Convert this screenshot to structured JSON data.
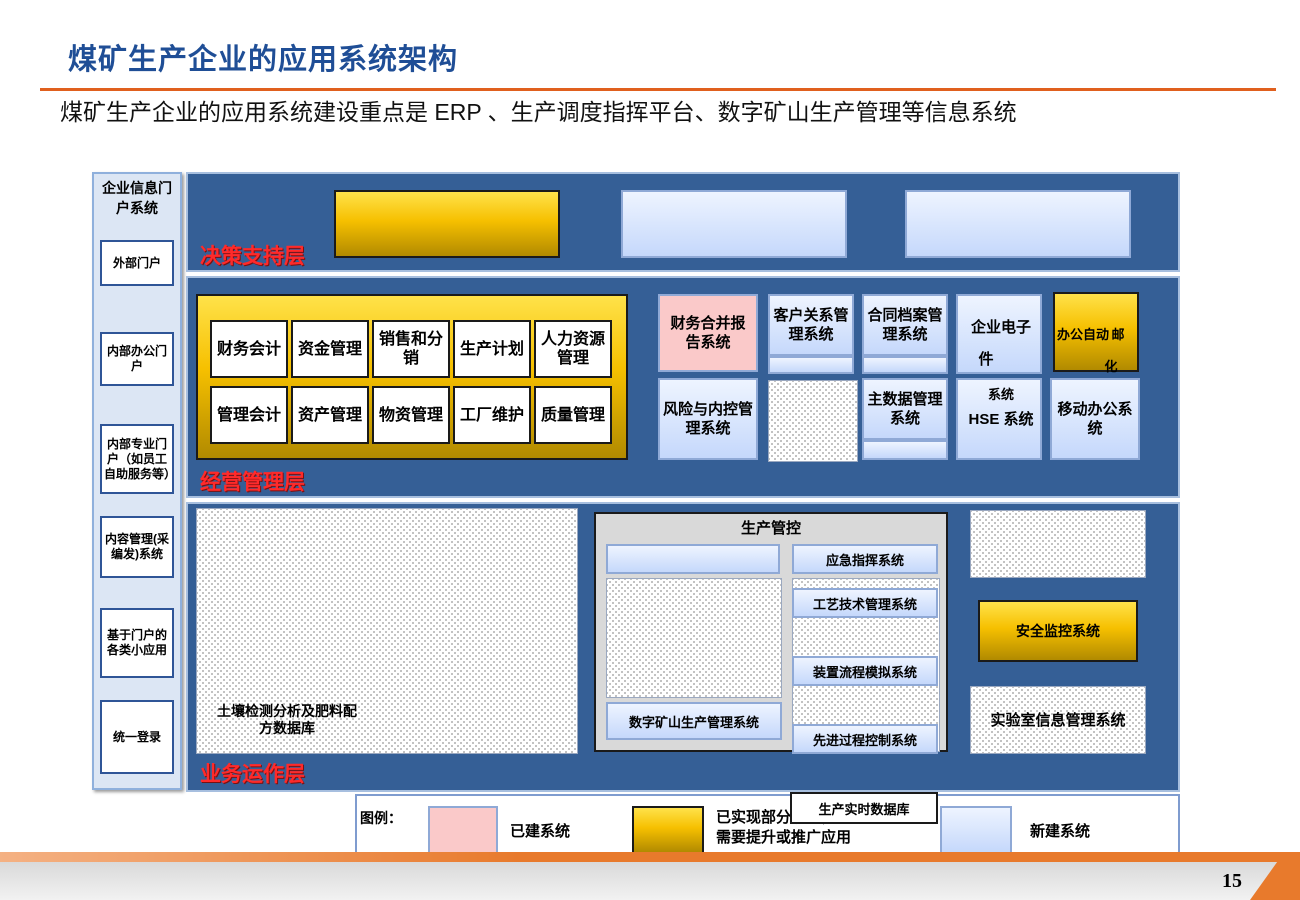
{
  "page": {
    "title": "煤矿生产企业的应用系统架构",
    "subtitle": "煤矿生产企业的应用系统建设重点是 ERP 、生产调度指挥平台、数字矿山生产管理等信息系统",
    "page_number": "15"
  },
  "portal": {
    "title": "企业信息门户系统",
    "items": [
      "外部门户",
      "内部办公门户",
      "内部专业门户（如员工自助服务等）",
      "内容管理(采编发)系统",
      "基于门户的各类小应用",
      "统一登录"
    ]
  },
  "decision_layer": {
    "label": "决策支持层"
  },
  "business_layer": {
    "label": "经营管理层",
    "erp_row1": [
      "财务会计",
      "资金管理",
      "销售和分销",
      "生产计划",
      "人力资源管理"
    ],
    "erp_row2": [
      "管理会计",
      "资产管理",
      "物资管理",
      "工厂维护",
      "质量管理"
    ],
    "finance_consolidation": "财务合并报告系统",
    "crm": "客户关系管理系统",
    "contract": "合同档案管理系统",
    "e_mail_a": "企业电子",
    "e_mail_b": "件",
    "office_a": "办公自动",
    "office_b": "化",
    "office_c": "邮",
    "risk": "风险与内控管理系统",
    "master_data": "主数据管理系统",
    "hse_top": "系统",
    "hse": "HSE 系统",
    "mobile": "移动办公系统"
  },
  "operations_layer": {
    "label": "业务运作层",
    "soil": "土壤检测分析及肥料配方数据库",
    "production_control": "生产管控",
    "emergency": "应急指挥系统",
    "process_tech": "工艺技术管理系统",
    "device_sim": "装置流程模拟系统",
    "advanced_control": "先进过程控制系统",
    "digital_mine": "数字矿山生产管理系统",
    "realtime_db": "生产实时数据库",
    "safety_monitor": "安全监控系统",
    "lab": "实验室信息管理系统"
  },
  "legend": {
    "title": "图例：",
    "built": "已建系统",
    "partial_a": "已实现部分功能，但",
    "partial_b": "需要提升或推广应用",
    "new": "新建系统"
  },
  "colors": {
    "layer_bg": "#355f96",
    "gold": "#f6c000",
    "light_blue": "#c5d8fb",
    "pink": "#fac9c9",
    "title_blue": "#1f4e96",
    "accent_orange": "#e87a2c",
    "label_red": "#ff2a2a"
  }
}
